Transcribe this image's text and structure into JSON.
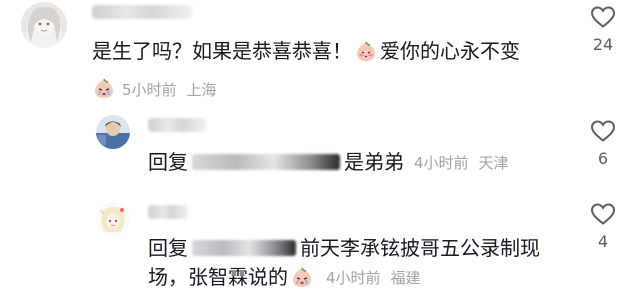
{
  "comments": [
    {
      "text": "是生了吗？如果是恭喜恭喜！",
      "text_tail": "爱你的心永不变",
      "time": "5小时前",
      "location": "上海",
      "likes": "24"
    },
    {
      "reply_prefix": "回复",
      "text": "是弟弟",
      "time": "4小时前",
      "location": "天津",
      "likes": "6"
    },
    {
      "reply_prefix": "回复",
      "text": "前天李承铉披哥五公录制现",
      "text_line2": "场，张智霖说的",
      "time": "4小时前",
      "location": "福建",
      "likes": "4"
    }
  ],
  "icons": {
    "like": "heart-outline-icon",
    "emoji_blush": "blushing-peach-emoji",
    "emoji_cry": "crying-peach-emoji"
  },
  "colors": {
    "text": "#161823",
    "meta": "#a1a2a7",
    "like_count": "#5c5d62"
  }
}
